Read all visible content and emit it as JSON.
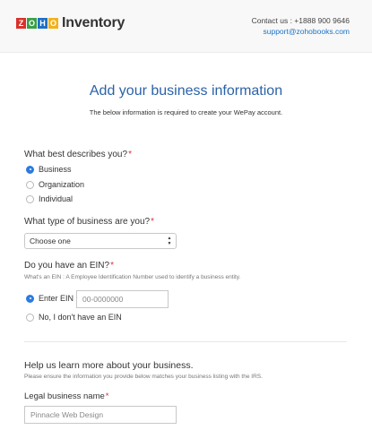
{
  "header": {
    "logo_letters": [
      {
        "char": "Z",
        "color": "#d8322b"
      },
      {
        "char": "O",
        "color": "#3aa047"
      },
      {
        "char": "H",
        "color": "#1d6fc7"
      },
      {
        "char": "O",
        "color": "#f2b21b"
      }
    ],
    "logo_text": "Inventory",
    "contact_line": "Contact us : +1888 900 9646",
    "support_email": "support@zohobooks.com"
  },
  "page": {
    "title": "Add your business information",
    "subtitle": "The below information is required to create your WePay account."
  },
  "q_describes": {
    "label": "What best describes you?",
    "required_mark": "*",
    "options": [
      {
        "label": "Business",
        "selected": true
      },
      {
        "label": "Organization",
        "selected": false
      },
      {
        "label": "Individual",
        "selected": false
      }
    ]
  },
  "q_type": {
    "label": "What type of business are you?",
    "required_mark": "*",
    "selected_value": "Choose one"
  },
  "q_ein": {
    "label": "Do you have an EIN?",
    "required_mark": "*",
    "hint": "What's an EIN : A Employee Identification Number used to identify a business entity.",
    "option_enter": {
      "label": "Enter EIN",
      "selected": true
    },
    "ein_placeholder": "00-0000000",
    "option_no": {
      "label": "No, I don't have an EIN",
      "selected": false
    }
  },
  "section2": {
    "title": "Help us learn more about your business.",
    "hint": "Please ensure the information you provide below matches your business listing with the IRS.",
    "legal_name_label": "Legal business name",
    "required_mark": "*",
    "legal_name_placeholder": "Pinnacle Web Design"
  },
  "colors": {
    "accent_blue": "#2d7be0",
    "title_blue": "#2b62a8",
    "required_red": "#d6303f"
  }
}
